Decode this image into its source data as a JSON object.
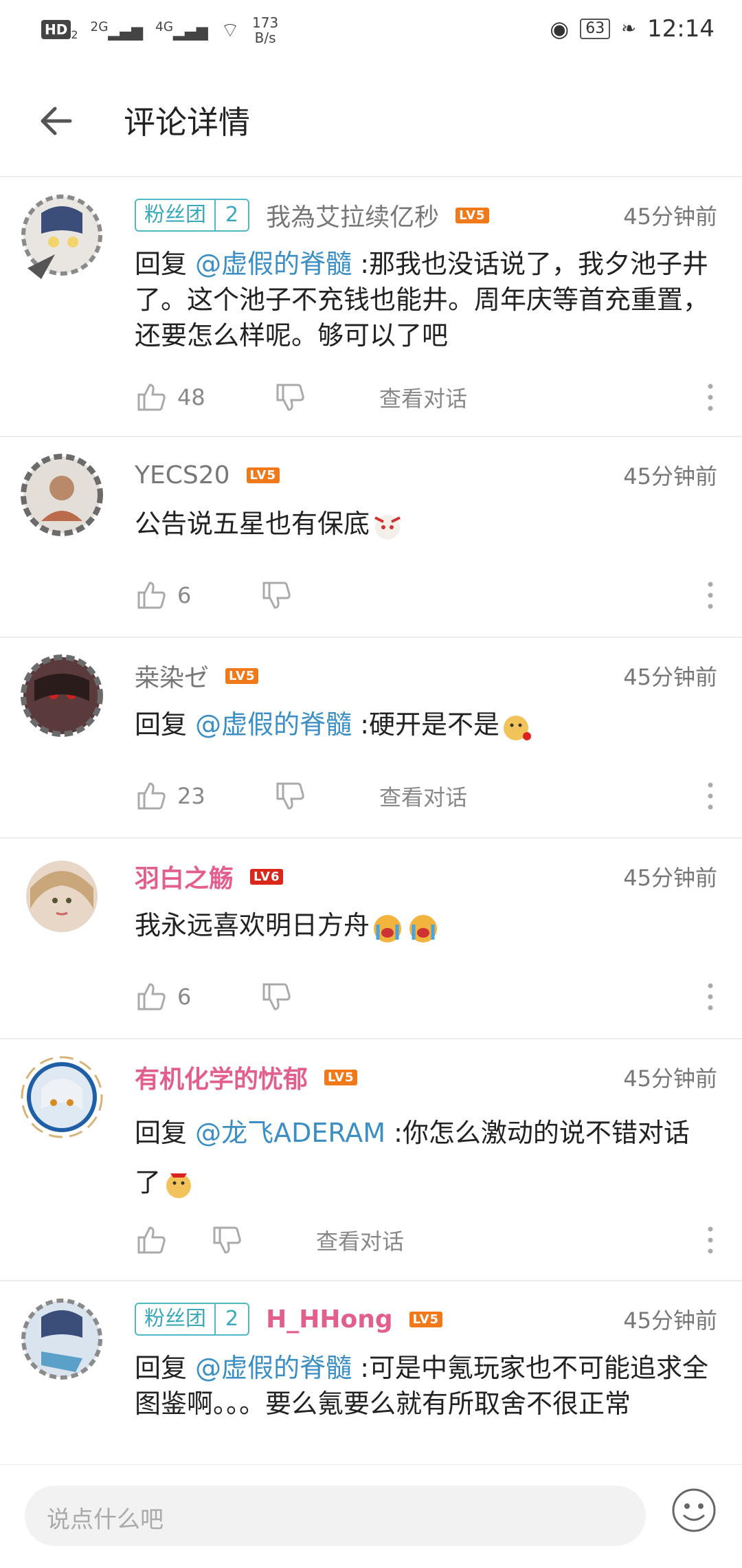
{
  "status_bar": {
    "hd": "HD",
    "hd_sub": "2",
    "sig1": "2G",
    "sig2": "4G",
    "speed_value": "173",
    "speed_unit": "B/s",
    "battery": "63",
    "time": "12:14"
  },
  "header": {
    "title": "评论详情"
  },
  "comments": [
    {
      "fan_label": "粉丝团",
      "fan_level": "2",
      "name": "我為艾拉续亿秒",
      "level": "LV5",
      "time": "45分钟前",
      "reply_prefix": "回复 ",
      "mention": "@虚假的脊髓",
      "text": " :那我也没话说了，我夕池子井了。这个池子不充钱也能井。周年庆等首充重置，还要怎么样呢。够可以了吧",
      "likes": "48",
      "view_convo": "查看对话"
    },
    {
      "name": "YECS20",
      "level": "LV5",
      "time": "45分钟前",
      "text": "公告说五星也有保底",
      "likes": "6"
    },
    {
      "name": "桒染ゼ",
      "level": "LV5",
      "time": "45分钟前",
      "reply_prefix": "回复 ",
      "mention": "@虚假的脊髓",
      "text": " :硬开是不是",
      "likes": "23",
      "view_convo": "查看对话"
    },
    {
      "name": "羽白之觞",
      "level": "LV6",
      "time": "45分钟前",
      "text": "我永远喜欢明日方舟",
      "likes": "6"
    },
    {
      "name": "有机化学的忧郁",
      "level": "LV5",
      "time": "45分钟前",
      "reply_prefix": "回复 ",
      "mention": "@龙飞ADERAM",
      "text": " :你怎么激动的说不错对话了",
      "view_convo": "查看对话"
    },
    {
      "fan_label": "粉丝团",
      "fan_level": "2",
      "name": "H_HHong",
      "level": "LV5",
      "time": "45分钟前",
      "reply_prefix": "回复 ",
      "mention": "@虚假的脊髓",
      "text": " :可是中氪玩家也不可能追求全图鉴啊。。。要么氪要么就有所取舍不很正常"
    }
  ],
  "bottom_bar": {
    "placeholder": "说点什么吧"
  }
}
